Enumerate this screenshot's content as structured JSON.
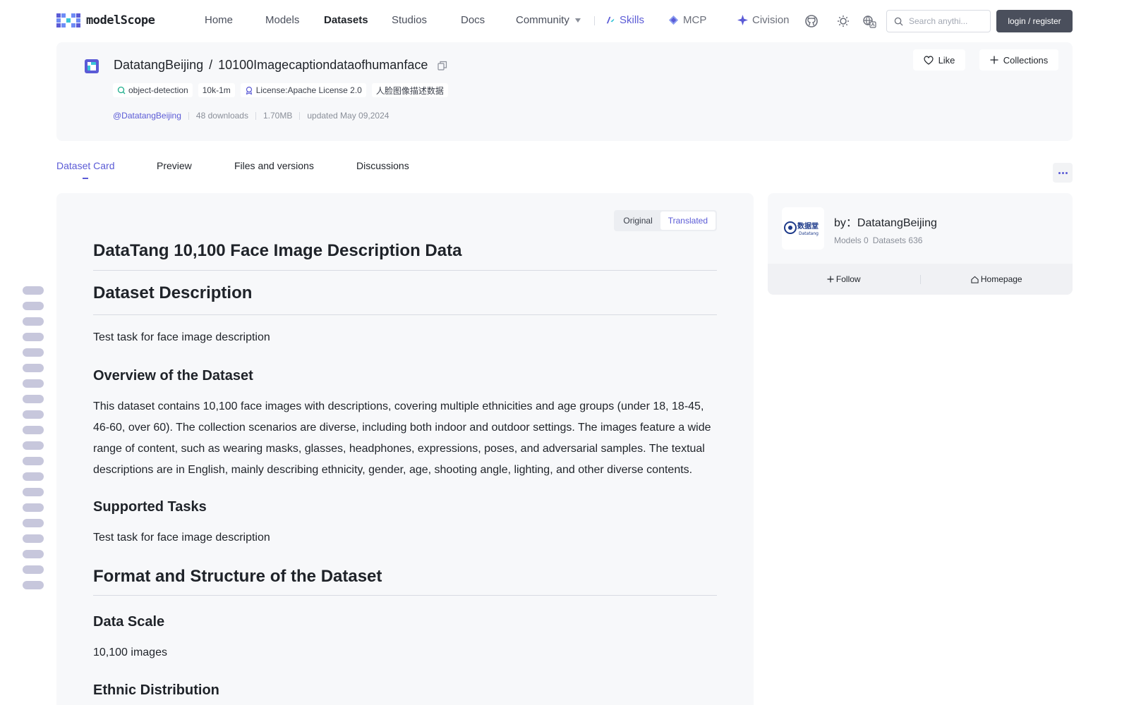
{
  "nav": {
    "logo_text": "modelScope",
    "home": "Home",
    "models": "Models",
    "datasets": "Datasets",
    "studios": "Studios",
    "docs": "Docs",
    "community": "Community",
    "skills": "Skills",
    "mcp": "MCP",
    "civision": "Civision",
    "search_placeholder": "Search anythi...",
    "login": "login / register"
  },
  "dataset": {
    "owner": "DatatangBeijing",
    "separator": "/",
    "name": "10100Imagecaptiondataofhumanface",
    "tags": {
      "task": "object-detection",
      "size": "10k-1m",
      "license": "License:Apache License 2.0",
      "chinese": "人脸图像描述数据"
    },
    "author_handle": "@DatatangBeijing",
    "downloads": "48 downloads",
    "filesize": "1.70MB",
    "updated": "updated May 09,2024",
    "like": "Like",
    "collections": "Collections"
  },
  "tabs": {
    "card": "Dataset Card",
    "preview": "Preview",
    "files": "Files and versions",
    "discussions": "Discussions"
  },
  "toggle": {
    "original": "Original",
    "translated": "Translated"
  },
  "content": {
    "title": "DataTang 10,100 Face Image Description Data",
    "description_h": "Dataset Description",
    "description_p": "Test task for face image description",
    "overview_h": "Overview of the Dataset",
    "overview_p": "This dataset contains 10,100 face images with descriptions, covering multiple ethnicities and age groups (under 18, 18-45, 46-60, over 60). The collection scenarios are diverse, including both indoor and outdoor settings. The images feature a wide range of content, such as wearing masks, glasses, headphones, expressions, poses, and adversarial samples. The textual descriptions are in English, mainly describing ethnicity, gender, age, shooting angle, lighting, and other diverse contents.",
    "tasks_h": "Supported Tasks",
    "tasks_p": "Test task for face image description",
    "format_h": "Format and Structure of the Dataset",
    "scale_h": "Data Scale",
    "scale_p": "10,100 images",
    "ethnic_h": "Ethnic Distribution"
  },
  "author": {
    "by_label": "by：DatatangBeijing",
    "models": "Models 0",
    "datasets": "Datasets 636",
    "follow": "Follow",
    "homepage": "Homepage",
    "logo_text": "数据堂",
    "logo_sub": "Datatang"
  },
  "colors": {
    "accent": "#5b5bd6",
    "panel": "#f7f8fa",
    "login_bg": "#4a4f5c"
  }
}
